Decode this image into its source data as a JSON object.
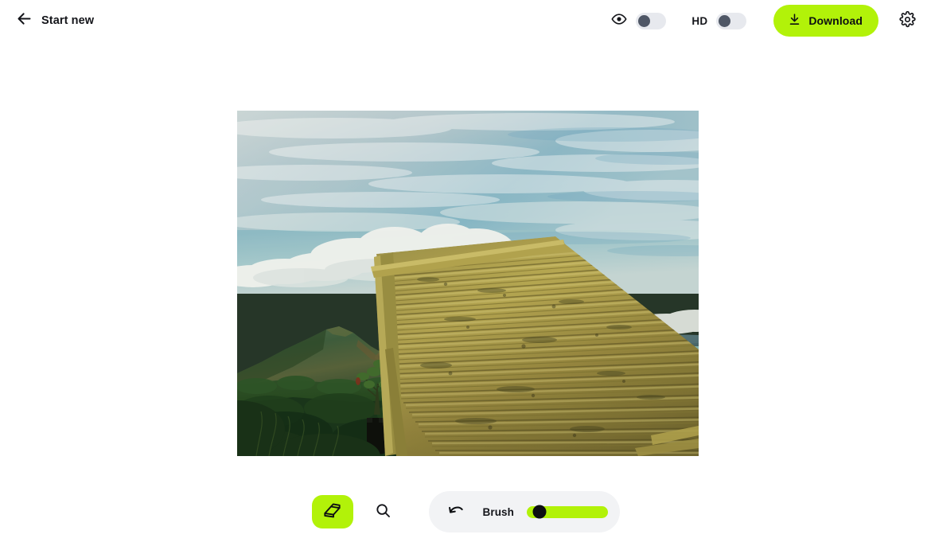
{
  "header": {
    "back_label": "Start new",
    "back_icon": "arrow-left-icon",
    "preview_icon": "eye-icon",
    "preview_toggle_state": "off",
    "hd_label": "HD",
    "hd_toggle_state": "off",
    "download_label": "Download",
    "download_icon": "download-icon",
    "settings_icon": "gear-icon",
    "accent_color": "#b2f209",
    "toggle_track_color": "#e7e9ee",
    "toggle_knob_color": "#4f5766"
  },
  "canvas": {
    "image_alt": "Taal Volcano landscape with bamboo deck overlooking lake",
    "image_width": "580",
    "image_height": "434",
    "background_color": "#ffffff"
  },
  "toolbar": {
    "eraser_icon": "eraser-icon",
    "eraser_active": "true",
    "zoom_icon": "magnifier-icon",
    "undo_icon": "undo-arrow-icon",
    "brush_label": "Brush",
    "brush_value": "16",
    "brush_min": "0",
    "brush_max": "100",
    "panel_background": "#f2f3f5",
    "slider_track_color": "#b2f209",
    "slider_thumb_color": "#0d0f12"
  }
}
